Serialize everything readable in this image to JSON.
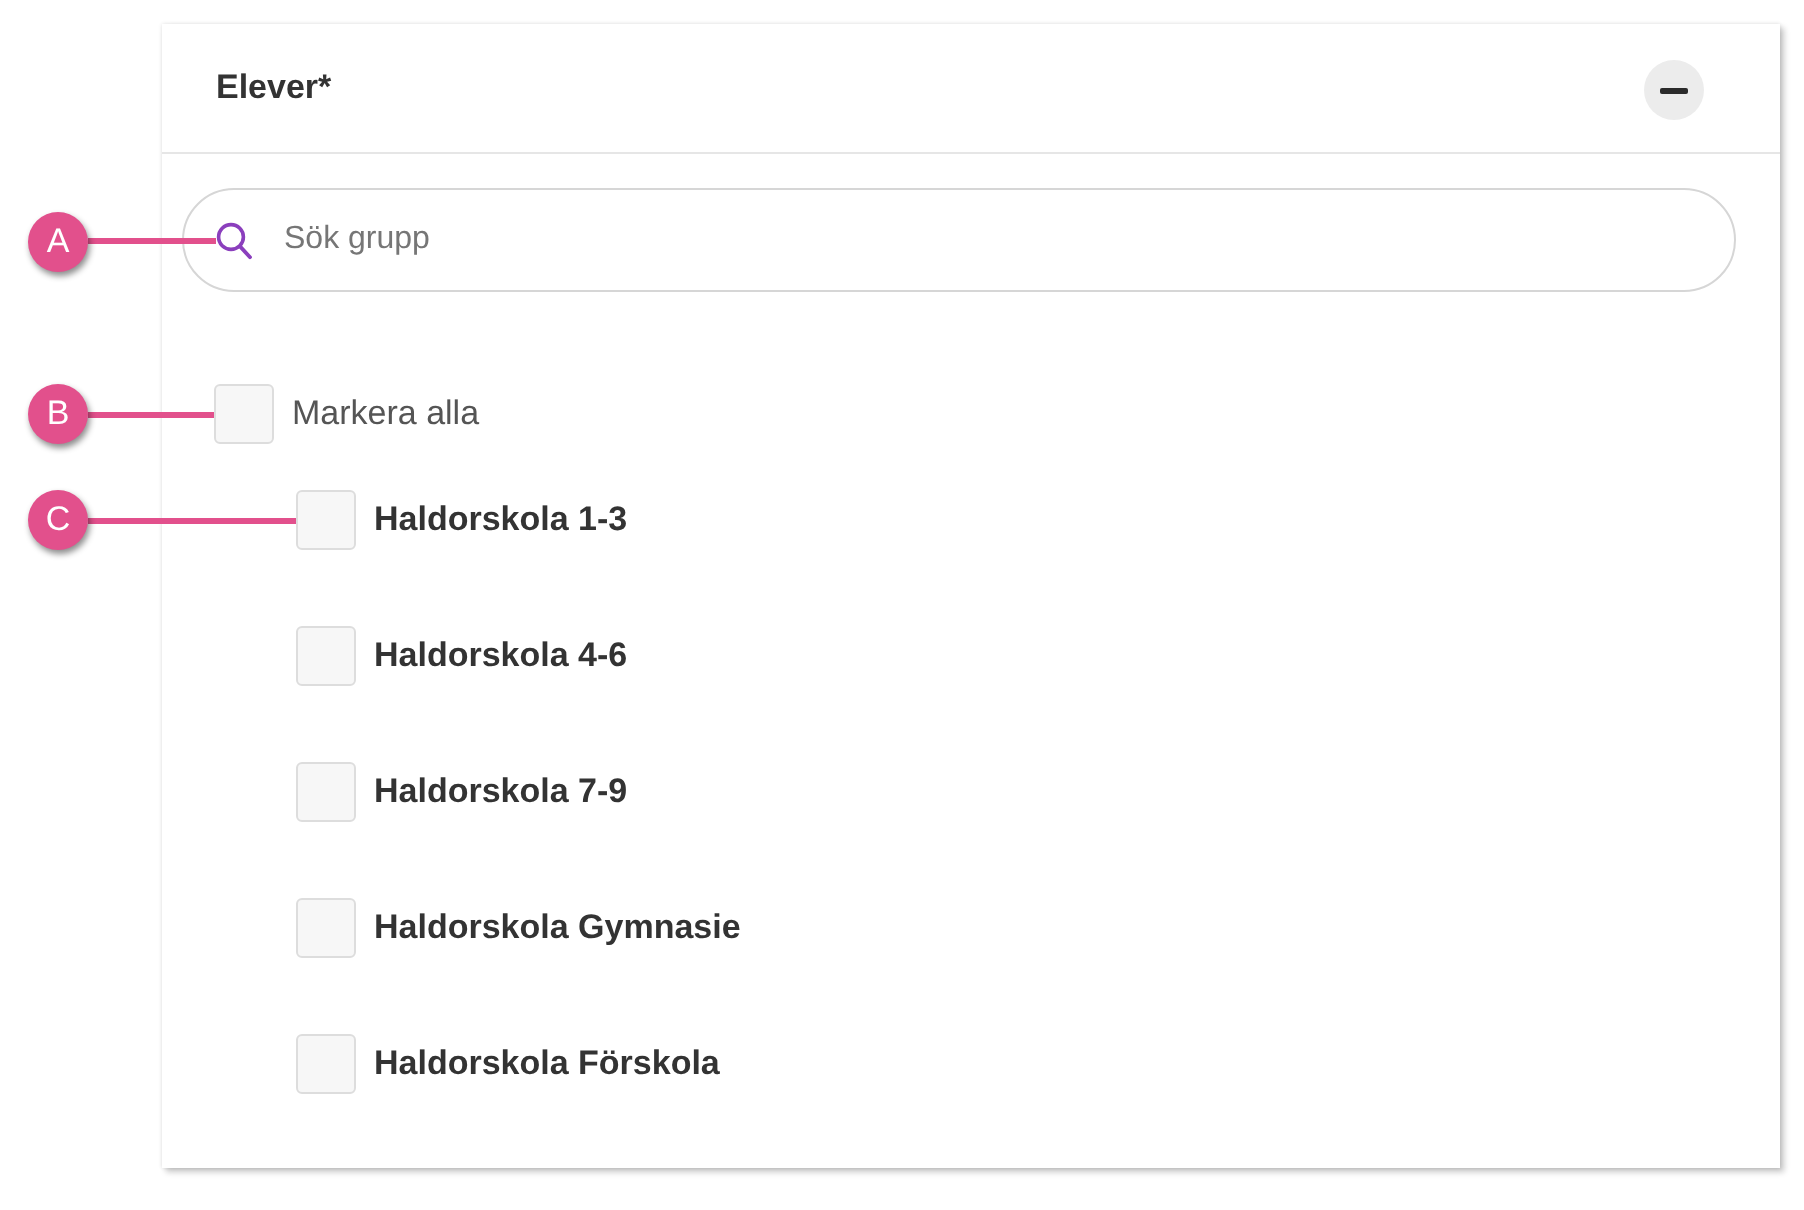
{
  "panel": {
    "title": "Elever*",
    "expanded": true,
    "search": {
      "placeholder": "Sök grupp",
      "callout": "A"
    },
    "select_all": {
      "label": "Markera alla",
      "checked": false,
      "callout": "B",
      "children": [
        {
          "label": "Haldorskola 1-3",
          "checked": false,
          "callout": "C"
        },
        {
          "label": "Haldorskola 4-6",
          "checked": false
        },
        {
          "label": "Haldorskola 7-9",
          "checked": false
        },
        {
          "label": "Haldorskola Gymnasie",
          "checked": false
        },
        {
          "label": "Haldorskola Förskola",
          "checked": false
        }
      ]
    }
  }
}
